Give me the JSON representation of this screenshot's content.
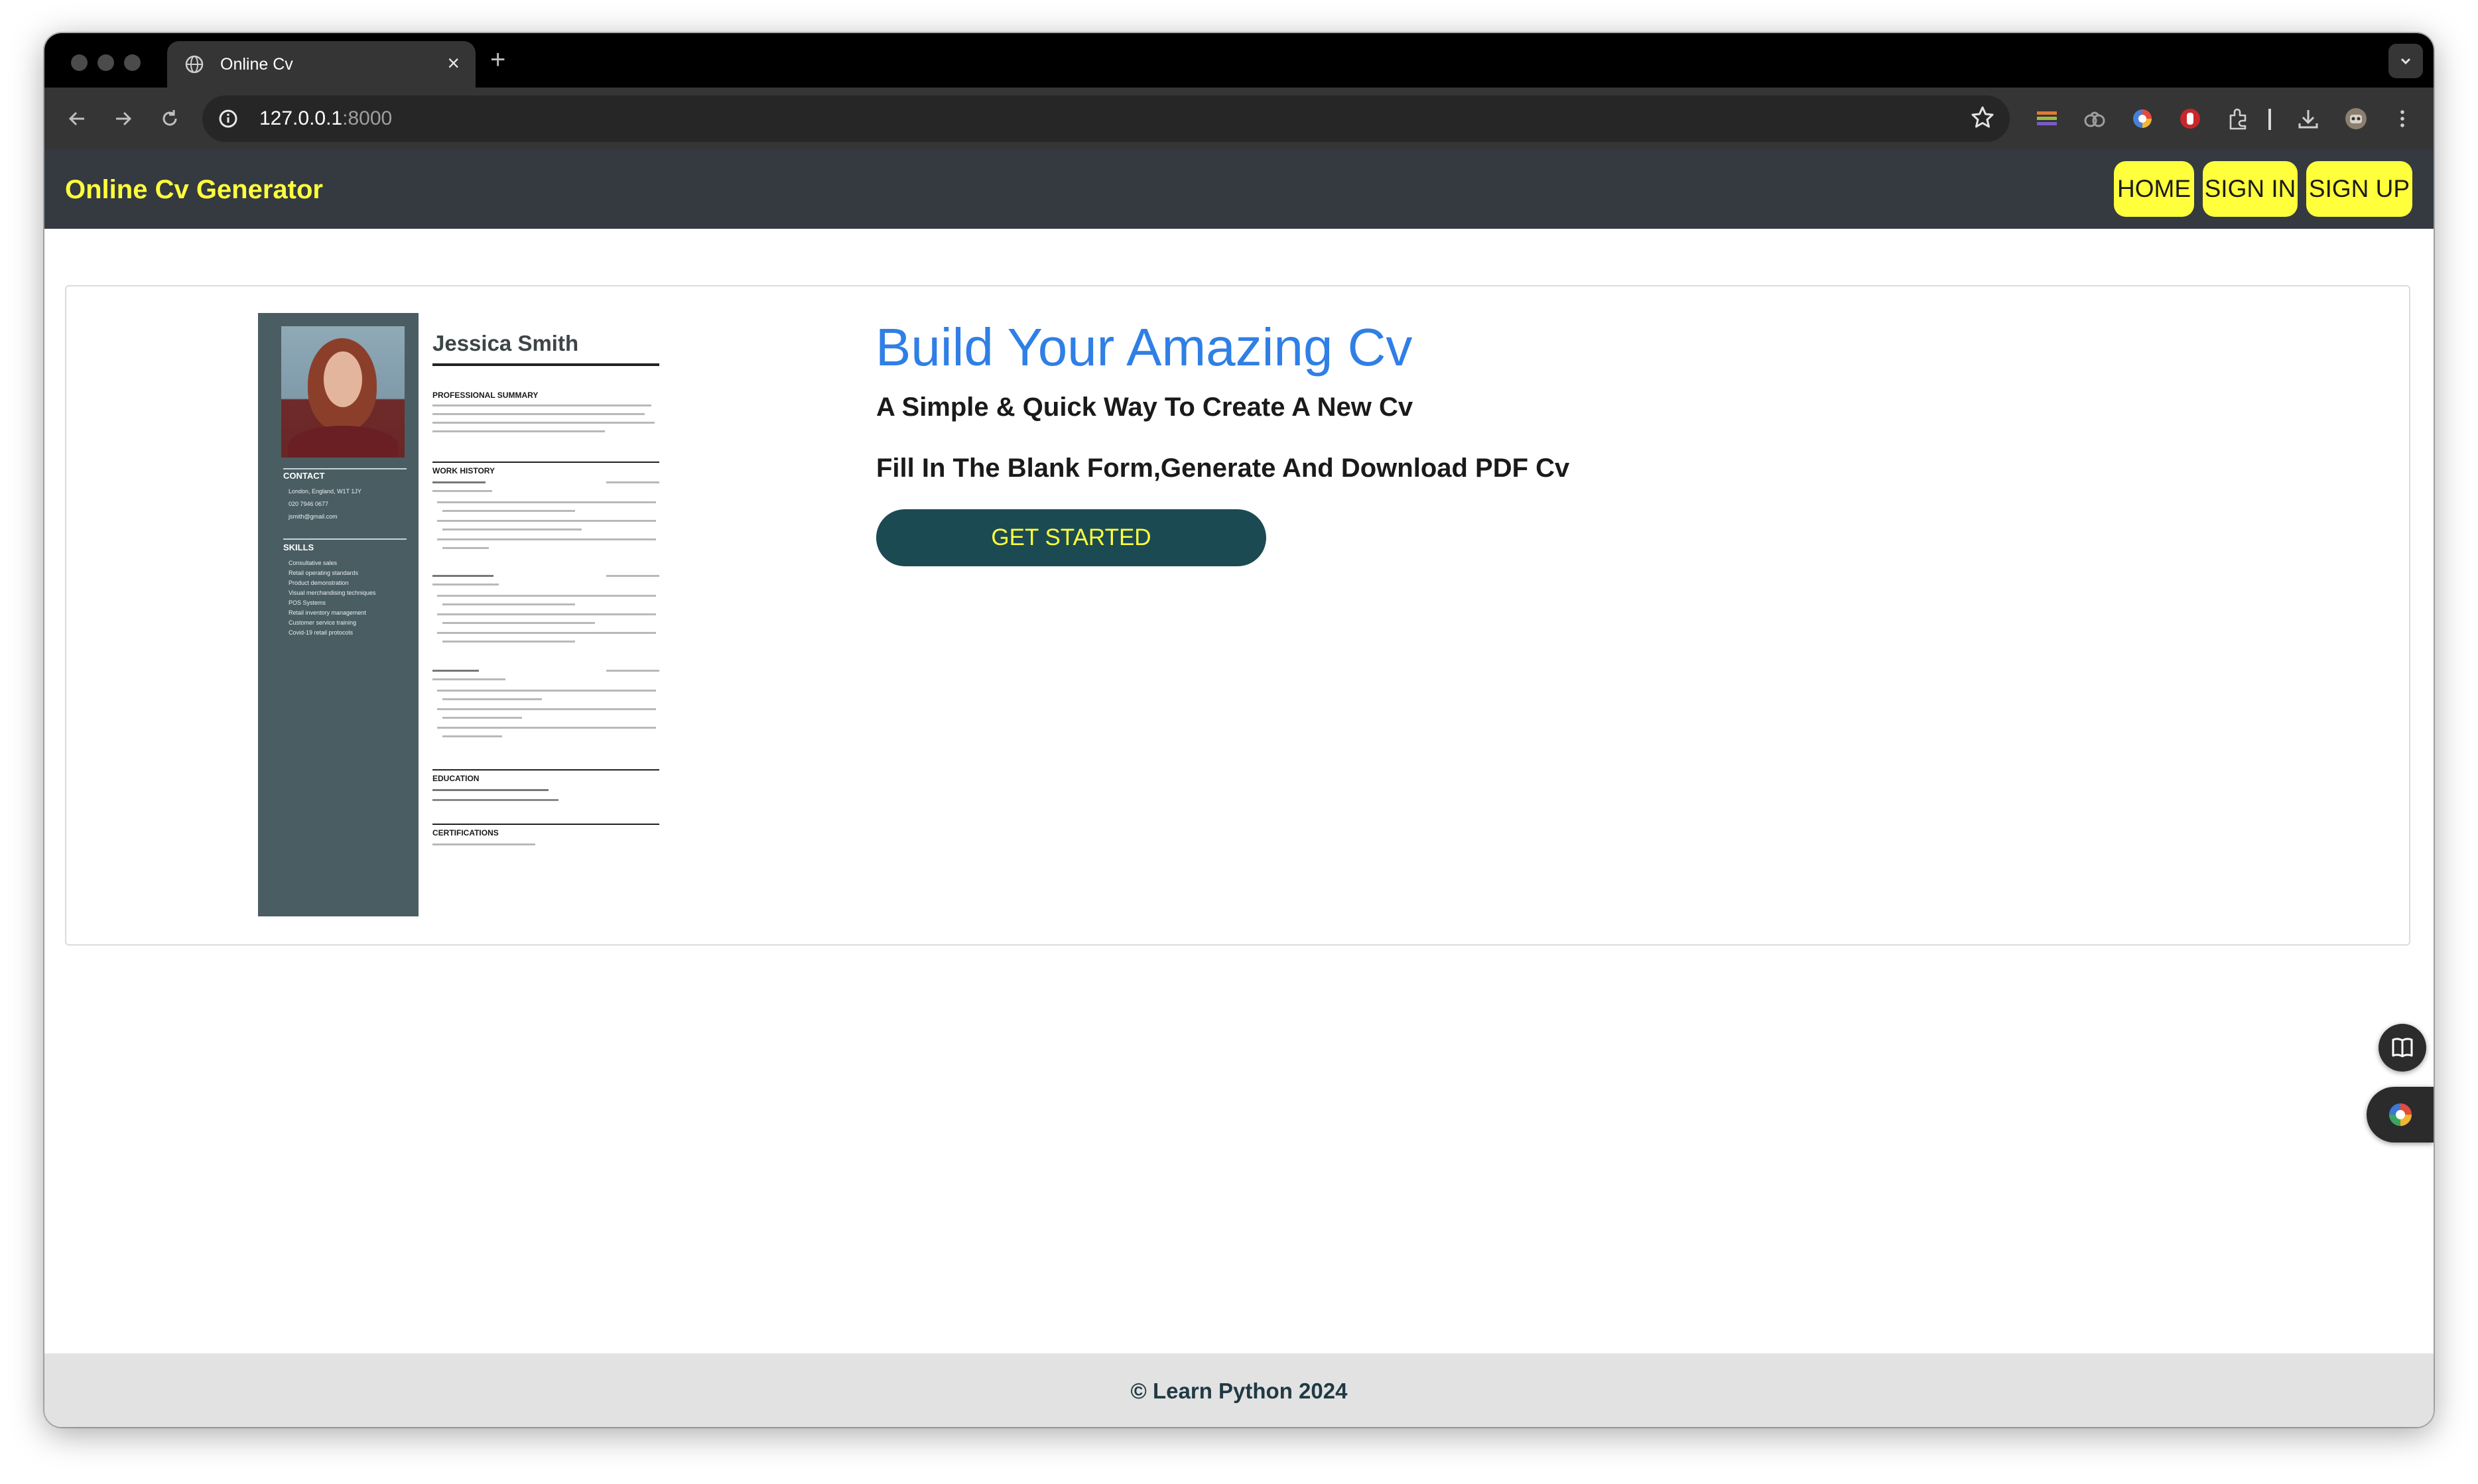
{
  "browser": {
    "tab_title": "Online Cv",
    "new_tab_label": "+",
    "close_tab_label": "×",
    "url_host": "127.0.0.1",
    "url_port": ":8000"
  },
  "site": {
    "brand": "Online Cv Generator",
    "nav": [
      "HOME",
      "SIGN IN",
      "SIGN UP"
    ],
    "accent_color": "#ffff3b",
    "navbar_color": "#343a40"
  },
  "hero": {
    "title": "Build Your Amazing Cv",
    "subtitle_1": "A Simple & Quick Way To Create A New Cv",
    "subtitle_2": "Fill In The Blank Form,Generate And Download PDF Cv",
    "cta_label": "GET STARTED",
    "title_color": "#2f7fe6",
    "cta_color": "#1c4a52"
  },
  "cv_preview": {
    "name": "Jessica Smith",
    "sections": [
      "PROFESSIONAL SUMMARY",
      "WORK HISTORY",
      "EDUCATION",
      "CERTIFICATIONS"
    ],
    "sidebar_sections": [
      "CONTACT",
      "SKILLS"
    ],
    "contact": [
      "London, England, W1T 1JY",
      "020 7946 0677",
      "jsmith@gmail.com"
    ],
    "skills": [
      "Consultative sales",
      "Retail operating standards",
      "Product demonstration",
      "Visual merchandising techniques",
      "POS Systems",
      "Retail inventory management",
      "Customer service training",
      "Covid-19 retail protocols"
    ]
  },
  "footer": {
    "text": "© Learn Python 2024"
  },
  "icons": [
    "globe-icon",
    "back-icon",
    "forward-icon",
    "reload-icon",
    "site-info-icon",
    "star-icon",
    "extensions-icon",
    "download-icon",
    "profile-icon",
    "more-icon",
    "reading-list-icon",
    "chrome-icon"
  ]
}
